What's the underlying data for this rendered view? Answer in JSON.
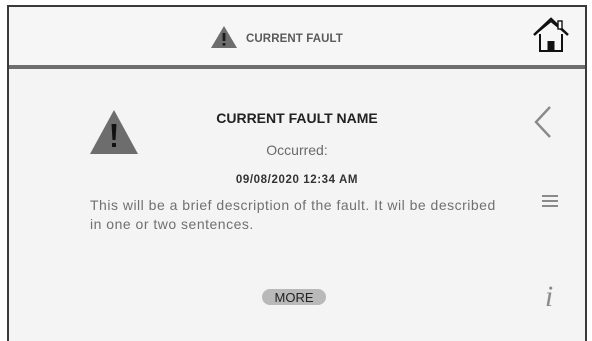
{
  "header": {
    "title": "CURRENT FAULT",
    "warning_icon": "warning-triangle-icon",
    "home_icon": "home-icon"
  },
  "fault": {
    "name": "CURRENT FAULT NAME",
    "occurred_label": "Occurred:",
    "timestamp": "09/08/2020 12:34 AM",
    "description": "This will be a brief description of the fault. It wil be described in one or two sentences.",
    "warning_icon": "warning-triangle-icon"
  },
  "actions": {
    "more_label": "MORE",
    "back_icon": "chevron-left-icon",
    "menu_icon": "hamburger-menu-icon",
    "info_icon": "info-icon",
    "info_glyph": "i"
  },
  "colors": {
    "background": "#f4f4f4",
    "divider": "#6e6e6e",
    "icon_gray": "#8a8a8a",
    "warning_gray": "#6d6d6d",
    "more_button": "#b9b9b9"
  }
}
